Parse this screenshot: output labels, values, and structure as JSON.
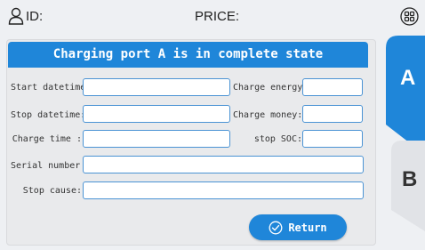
{
  "topbar": {
    "id_label": "ID:",
    "price_label": "PRICE:"
  },
  "panel": {
    "title": "Charging port A is in complete state",
    "fields": {
      "start_datetime": {
        "label": "Start datetime:",
        "value": ""
      },
      "stop_datetime": {
        "label": "Stop datetime:",
        "value": ""
      },
      "charge_time": {
        "label": "Charge time :",
        "value": ""
      },
      "serial_number": {
        "label": "Serial number :",
        "value": ""
      },
      "stop_cause": {
        "label": "Stop cause:",
        "value": ""
      },
      "charge_energy": {
        "label": "Charge energy:",
        "value": ""
      },
      "charge_money": {
        "label": "Charge money:",
        "value": ""
      },
      "stop_soc": {
        "label": "stop SOC:",
        "value": ""
      }
    },
    "return_label": "Return"
  },
  "tabs": [
    {
      "label": "A",
      "active": true
    },
    {
      "label": "B",
      "active": false
    }
  ],
  "colors": {
    "accent": "#1f86d9",
    "background": "#eef0f3",
    "field_border": "#4b93d4"
  },
  "icons": {
    "user": "user-icon",
    "menu": "grid-menu-icon",
    "return": "check-circle-icon"
  }
}
